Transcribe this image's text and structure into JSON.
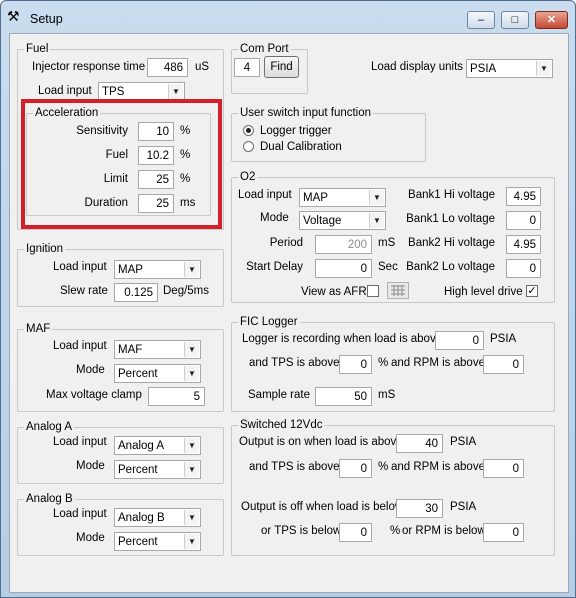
{
  "window": {
    "title": "Setup",
    "icon": "tools-icon",
    "minimize": "–",
    "maximize": "□",
    "close": "✕"
  },
  "fuel": {
    "legend": "Fuel",
    "injector_label": "Injector response time",
    "injector_value": "486",
    "injector_unit": "uS",
    "load_input_label": "Load input",
    "load_input_value": "TPS"
  },
  "acceleration": {
    "legend": "Acceleration",
    "sensitivity_label": "Sensitivity",
    "sensitivity_value": "10",
    "sensitivity_unit": "%",
    "fuel_label": "Fuel",
    "fuel_value": "10.2",
    "fuel_unit": "%",
    "limit_label": "Limit",
    "limit_value": "25",
    "limit_unit": "%",
    "duration_label": "Duration",
    "duration_value": "25",
    "duration_unit": "ms",
    "highlight_color": "#d3202a"
  },
  "comport": {
    "legend": "Com Port",
    "value": "4",
    "find_label": "Find"
  },
  "load_display": {
    "label": "Load display units",
    "value": "PSIA"
  },
  "user_switch": {
    "legend": "User switch input function",
    "options": [
      "Logger trigger",
      "Dual Calibration"
    ],
    "selected": 0
  },
  "ignition": {
    "legend": "Ignition",
    "load_input_label": "Load input",
    "load_input_value": "MAP",
    "slew_label": "Slew rate",
    "slew_value": "0.125",
    "slew_unit": "Deg/5ms"
  },
  "o2": {
    "legend": "O2",
    "load_input_label": "Load input",
    "load_input_value": "MAP",
    "mode_label": "Mode",
    "mode_value": "Voltage",
    "period_label": "Period",
    "period_value": "200",
    "period_unit": "mS",
    "start_delay_label": "Start Delay",
    "start_delay_value": "0",
    "start_delay_unit": "Sec",
    "view_afr_label": "View as AFR",
    "view_afr_checked": false,
    "bank1_hi_label": "Bank1 Hi voltage",
    "bank1_hi_value": "4.95",
    "bank1_lo_label": "Bank1 Lo voltage",
    "bank1_lo_value": "0",
    "bank2_hi_label": "Bank2 Hi voltage",
    "bank2_hi_value": "4.95",
    "bank2_lo_label": "Bank2 Lo voltage",
    "bank2_lo_value": "0",
    "high_level_label": "High level drive",
    "high_level_checked": true
  },
  "maf": {
    "legend": "MAF",
    "load_input_label": "Load input",
    "load_input_value": "MAF",
    "mode_label": "Mode",
    "mode_value": "Percent",
    "max_voltage_label": "Max voltage clamp",
    "max_voltage_value": "5"
  },
  "fic_logger": {
    "legend": "FIC Logger",
    "recording_label": "Logger is recording when load is above",
    "recording_value": "0",
    "recording_unit": "PSIA",
    "tps_label": "and TPS is above",
    "tps_value": "0",
    "tps_unit": "%",
    "rpm_label": "and RPM is above",
    "rpm_value": "0",
    "sample_label": "Sample rate",
    "sample_value": "50",
    "sample_unit": "mS"
  },
  "analog_a": {
    "legend": "Analog A",
    "load_input_label": "Load input",
    "load_input_value": "Analog A",
    "mode_label": "Mode",
    "mode_value": "Percent"
  },
  "analog_b": {
    "legend": "Analog B",
    "load_input_label": "Load input",
    "load_input_value": "Analog B",
    "mode_label": "Mode",
    "mode_value": "Percent"
  },
  "switched": {
    "legend": "Switched 12Vdc",
    "on_label": "Output is on when load is above",
    "on_value": "40",
    "on_unit": "PSIA",
    "on_tps_label": "and TPS is above",
    "on_tps_value": "0",
    "on_tps_unit": "%",
    "on_rpm_label": "and RPM is above",
    "on_rpm_value": "0",
    "off_label": "Output is off when load is below",
    "off_value": "30",
    "off_unit": "PSIA",
    "off_tps_label": "or TPS is below",
    "off_tps_value": "0",
    "off_tps_unit": "%",
    "off_rpm_label": "or RPM is below",
    "off_rpm_value": "0"
  }
}
